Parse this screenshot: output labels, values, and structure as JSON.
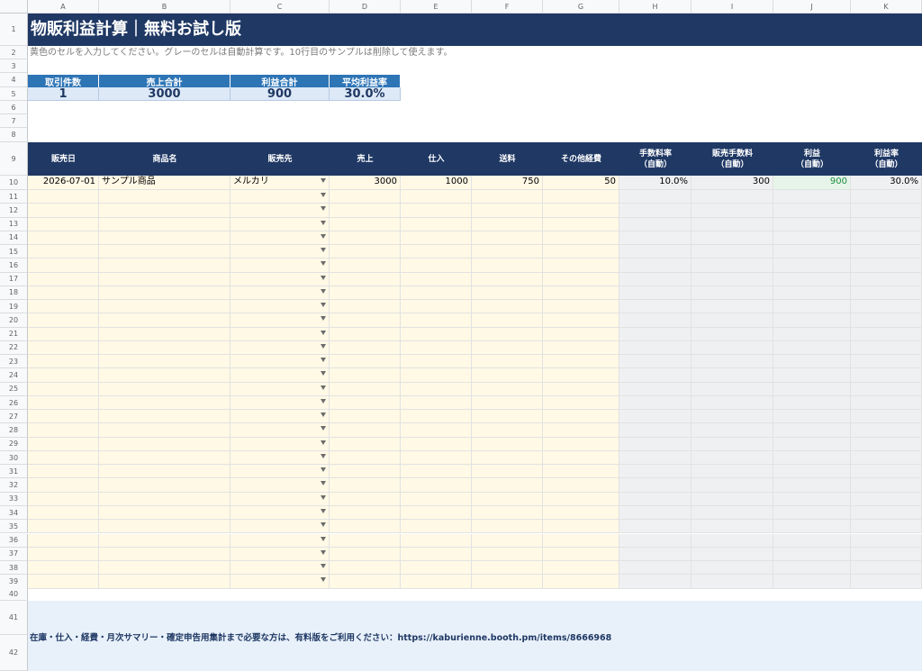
{
  "columns": [
    "A",
    "B",
    "C",
    "D",
    "E",
    "F",
    "G",
    "H",
    "I",
    "J",
    "K"
  ],
  "title": "物販利益計算｜無料お試し版",
  "note": "黄色のセルを入力してください。グレーのセルは自動計算です。10行目のサンプルは削除して使えます。",
  "summary": {
    "headers": [
      "取引件数",
      "売上合計",
      "利益合計",
      "平均利益率"
    ],
    "values": [
      "1",
      "3000",
      "900",
      "30.0%"
    ]
  },
  "table": {
    "headers": [
      {
        "l1": "販売日",
        "l2": ""
      },
      {
        "l1": "商品名",
        "l2": ""
      },
      {
        "l1": "販売先",
        "l2": ""
      },
      {
        "l1": "売上",
        "l2": ""
      },
      {
        "l1": "仕入",
        "l2": ""
      },
      {
        "l1": "送料",
        "l2": ""
      },
      {
        "l1": "その他経費",
        "l2": ""
      },
      {
        "l1": "手数料率",
        "l2": "（自動）"
      },
      {
        "l1": "販売手数料",
        "l2": "（自動）"
      },
      {
        "l1": "利益",
        "l2": "（自動）"
      },
      {
        "l1": "利益率",
        "l2": "（自動）"
      }
    ],
    "sample_row": {
      "date": "2026-07-01",
      "product": "サンプル商品",
      "channel": "メルカリ",
      "sales": "3000",
      "purchase": "1000",
      "shipping": "750",
      "other": "50",
      "fee_rate": "10.0%",
      "fee": "300",
      "profit": "900",
      "margin": "30.0%"
    }
  },
  "footer": "在庫・仕入・経費・月次サマリー・確定申告用集計まで必要な方は、有料版をご利用ください：https://kaburienne.booth.pm/items/8666968"
}
